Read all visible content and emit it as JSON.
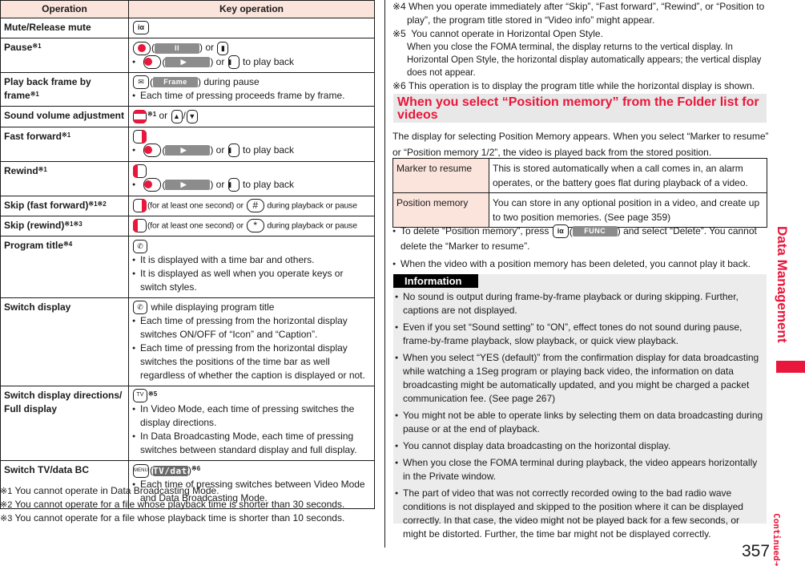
{
  "table": {
    "headers": {
      "operation": "Operation",
      "key_operation": "Key operation"
    },
    "rows": [
      {
        "operation": "Mute/Release mute",
        "note": ""
      },
      {
        "operation": "Pause",
        "note": "※1",
        "line1_or": ") or ",
        "softkey_pause": "II",
        "line2_or": ") or ",
        "line2_suffix": " to play back",
        "softkey_play": "▶"
      },
      {
        "operation": "Play back frame by frame",
        "note": "※1",
        "softkey": "Frame",
        "line1_suffix": ") during pause",
        "bullets": [
          "Each time of pressing proceeds frame by frame."
        ]
      },
      {
        "operation": "Sound volume adjustment",
        "note": "",
        "key_note": "※1",
        "line1_or": " or ",
        "slash": "/"
      },
      {
        "operation": "Fast forward",
        "note": "※1",
        "line2_or": ") or ",
        "line2_suffix": " to play back",
        "softkey_play": "▶"
      },
      {
        "operation": "Rewind",
        "note": "※1",
        "line2_or": ") or ",
        "line2_suffix": " to play back",
        "softkey_play": "▶"
      },
      {
        "operation": "Skip (fast forward)",
        "note": "※1※2",
        "mid": "(for at least one second) or ",
        "key_label": "#",
        "suffix": " during playback or pause"
      },
      {
        "operation": "Skip (rewind)",
        "note": "※1※3",
        "mid": "(for at least one second) or ",
        "key_label": "*",
        "suffix": " during playback or pause"
      },
      {
        "operation": "Program title",
        "note": "※4",
        "bullets": [
          "It is displayed with a time bar and others.",
          "It is displayed as well when you operate keys or switch styles."
        ]
      },
      {
        "operation": "Switch display",
        "note": "",
        "line1_suffix": " while displaying program title",
        "bullets": [
          "Each time of pressing from the horizontal display switches ON/OFF of “Icon” and “Caption”.",
          "Each time of pressing from the horizontal display switches the positions of the time bar as well regardless of whether the caption is displayed or not."
        ]
      },
      {
        "operation": "Switch display directions/ Full display",
        "note": "",
        "key_label": "TV",
        "key_note": "※5",
        "bullets": [
          "In Video Mode, each time of pressing switches the display directions.",
          "In Data Broadcasting Mode, each time of pressing switches between standard display and full display."
        ]
      },
      {
        "operation": "Switch TV/data BC",
        "note": "",
        "key_label": "MENU",
        "softkey": "TV/data",
        "key_note": "※6",
        "bullets": [
          "Each time of pressing switches between Video Mode and Data Broadcasting Mode."
        ]
      }
    ]
  },
  "left_footnotes": [
    {
      "mark": "※1",
      "text": "You cannot operate in Data Broadcasting Mode."
    },
    {
      "mark": "※2",
      "text": "You cannot operate for a file whose playback time is shorter than 30 seconds."
    },
    {
      "mark": "※3",
      "text": "You cannot operate for a file whose playback time is shorter than 10 seconds."
    }
  ],
  "right_footnotes": [
    {
      "mark": "※4",
      "text": "When you operate immediately after “Skip”, “Fast forward”, “Rewind”, or “Position to play”, the program title stored in “Video info” might appear."
    },
    {
      "mark": "※5",
      "text": "You cannot operate in Horizontal Open Style.",
      "body": "When you close the FOMA terminal, the display returns to the vertical display. In Horizontal Open Style, the horizontal display automatically appears; the vertical display does not appear."
    },
    {
      "mark": "※6",
      "text": "This operation is to display the program title while the horizontal display is shown."
    }
  ],
  "section": {
    "title": "When you select “Position memory” from the Folder list for videos",
    "intro": "The display for selecting Position Memory appears. When you select “Marker to resume” or “Position memory 1/2”, the video is played back from the stored position.",
    "rows": [
      {
        "label": "Marker to resume",
        "text": "This is stored automatically when a call comes in, an alarm operates, or the battery goes flat during playback of a video."
      },
      {
        "label": "Position memory",
        "text": "You can store in any optional position in a video, and create up to two position memories. (See page 359)"
      }
    ],
    "notes": {
      "delete_prefix": "To delete “Position memory”, press ",
      "func_softkey": "FUNC",
      "delete_suffix": ") and select “Delete”. You cannot delete the “Marker to resume”.",
      "deleted_video": "When the video with a position memory has been deleted, you cannot play it back."
    }
  },
  "information": {
    "label": "Information",
    "items": [
      "No sound is output during frame-by-frame playback or during skipping. Further, captions are not displayed.",
      "Even if you set “Sound setting” to “ON”, effect tones do not sound during pause, frame-by-frame playback, slow playback, or quick view playback.",
      "When you select “YES (default)” from the confirmation display for data broadcasting while watching a 1Seg program or playing back video, the information on data broadcasting might be automatically updated, and you might be charged a packet communication fee. (See page 267)",
      "You might not be able to operate links by selecting them on data broadcasting during pause or at the end of playback.",
      "You cannot display data broadcasting on the horizontal display.",
      "When you close the FOMA terminal during playback, the video appears horizontally in the Private window.",
      "The part of video that was not correctly recorded owing to the bad radio wave conditions is not displayed and skipped to the position where it can be displayed correctly. In that case, the video might not be played back for a few seconds, or might be distorted. Further, the time bar might not be displayed correctly."
    ]
  },
  "side": {
    "chapter": "Data Management",
    "page_number": "357",
    "continued": "Continued"
  },
  "colors": {
    "accent": "#e8173b",
    "header_bg": "#fbe4dc",
    "info_bg": "#ececec"
  }
}
